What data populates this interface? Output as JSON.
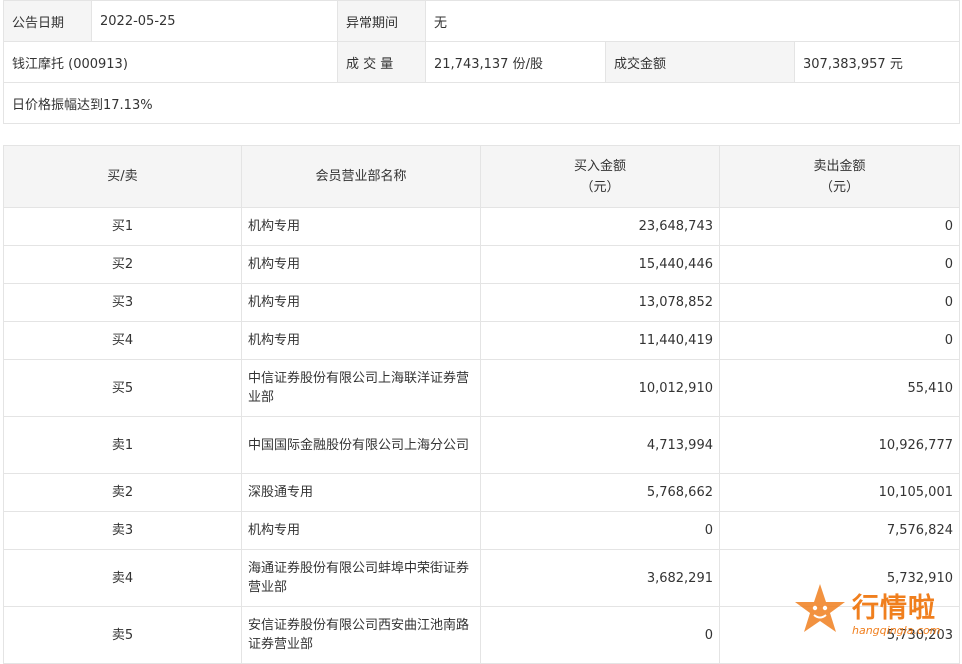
{
  "info": {
    "announce_date_label": "公告日期",
    "announce_date": "2022-05-25",
    "abnormal_period_label": "异常期间",
    "abnormal_period": "无",
    "stock_name": "钱江摩托 (000913)",
    "volume_label": "成 交 量",
    "volume": "21,743,137 份/股",
    "amount_label": "成交金额",
    "amount": "307,383,957 元",
    "reason": "日价格振幅达到17.13%"
  },
  "table": {
    "headers": {
      "side": "买/卖",
      "dept": "会员营业部名称",
      "buy": "买入金额\n（元）",
      "sell": "卖出金额\n（元）"
    },
    "rows": [
      {
        "side": "买1",
        "dept": "机构专用",
        "buy": "23,648,743",
        "sell": "0"
      },
      {
        "side": "买2",
        "dept": "机构专用",
        "buy": "15,440,446",
        "sell": "0"
      },
      {
        "side": "买3",
        "dept": "机构专用",
        "buy": "13,078,852",
        "sell": "0"
      },
      {
        "side": "买4",
        "dept": "机构专用",
        "buy": "11,440,419",
        "sell": "0"
      },
      {
        "side": "买5",
        "dept": "中信证券股份有限公司上海联洋证券营业部",
        "buy": "10,012,910",
        "sell": "55,410"
      },
      {
        "side": "卖1",
        "dept": "中国国际金融股份有限公司上海分公司",
        "buy": "4,713,994",
        "sell": "10,926,777"
      },
      {
        "side": "卖2",
        "dept": "深股通专用",
        "buy": "5,768,662",
        "sell": "10,105,001"
      },
      {
        "side": "卖3",
        "dept": "机构专用",
        "buy": "0",
        "sell": "7,576,824"
      },
      {
        "side": "卖4",
        "dept": "海通证券股份有限公司蚌埠中荣街证券营业部",
        "buy": "3,682,291",
        "sell": "5,732,910"
      },
      {
        "side": "卖5",
        "dept": "安信证券股份有限公司西安曲江池南路证券营业部",
        "buy": "0",
        "sell": "5,730,203"
      }
    ]
  },
  "watermark": {
    "text": "行情啦",
    "url": "hangqingla.com",
    "color": "#f07f1e"
  }
}
